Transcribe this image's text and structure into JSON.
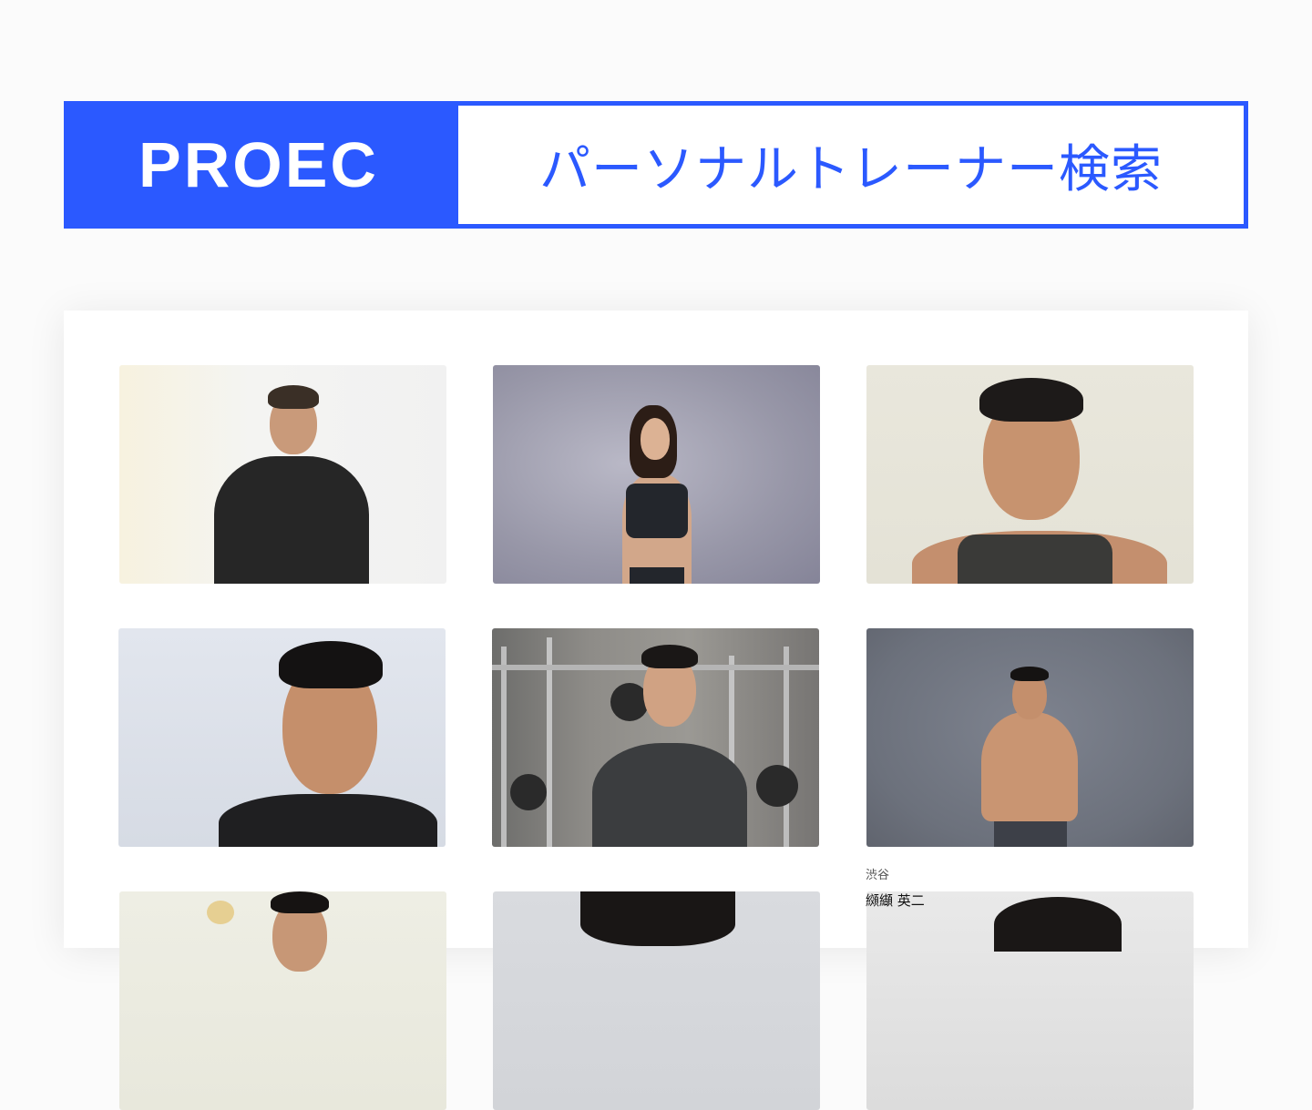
{
  "header": {
    "brand": "PROEC",
    "page_title": "パーソナルトレーナー検索"
  },
  "colors": {
    "accent": "#2b59ff",
    "panel_bg": "#ffffff",
    "page_bg": "#fbfbfb"
  },
  "trainers": [
    {
      "photo_icon": "trainer-photo"
    },
    {
      "photo_icon": "trainer-photo"
    },
    {
      "photo_icon": "trainer-photo"
    },
    {
      "photo_icon": "trainer-photo"
    },
    {
      "photo_icon": "trainer-photo"
    },
    {
      "photo_icon": "trainer-photo"
    },
    {
      "photo_icon": "trainer-photo"
    },
    {
      "photo_icon": "trainer-photo"
    },
    {
      "photo_icon": "trainer-photo",
      "area": "渋谷",
      "name": "纐纈 英二"
    }
  ]
}
